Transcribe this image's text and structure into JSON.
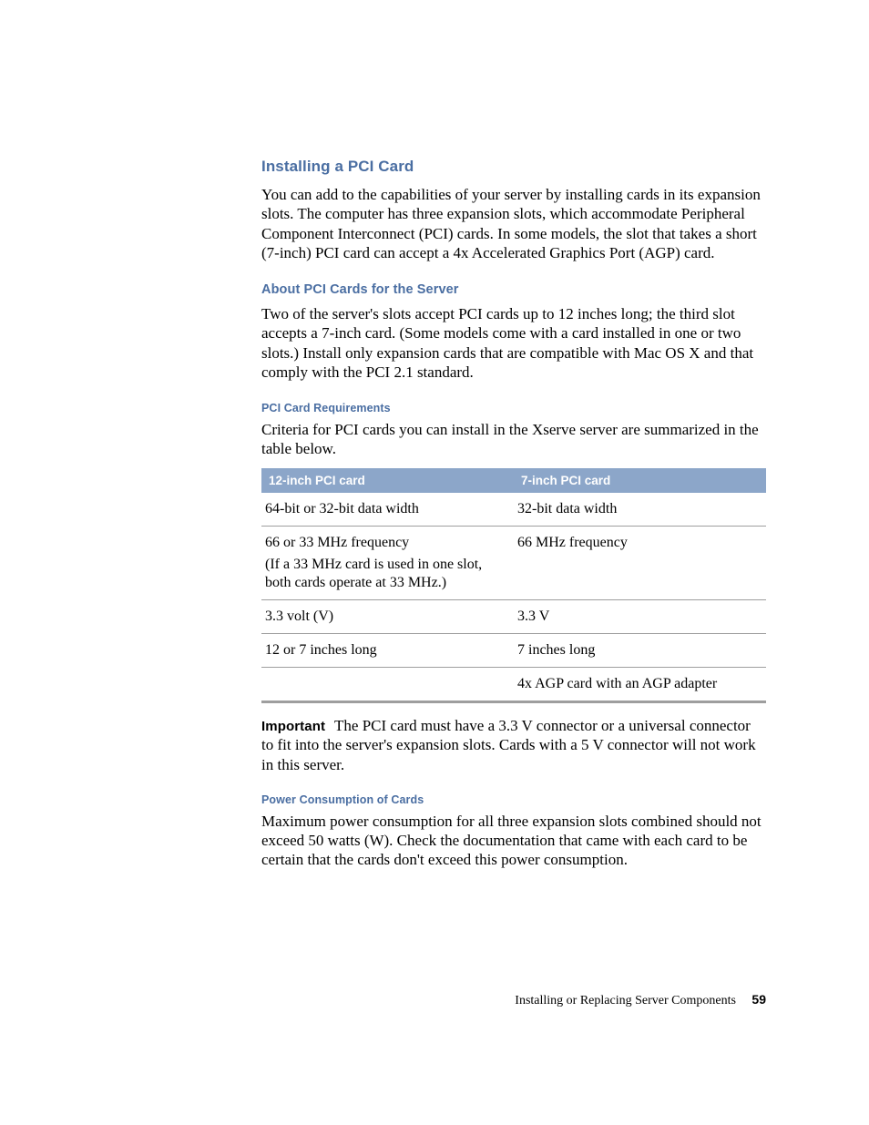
{
  "h1": "Installing a PCI Card",
  "p1": "You can add to the capabilities of your server by installing cards in its expansion slots. The computer has three expansion slots, which accommodate Peripheral Component Interconnect (PCI) cards. In some models, the slot that takes a short (7-inch) PCI card can accept a 4x Accelerated Graphics Port (AGP) card.",
  "h2a": "About PCI Cards for the Server",
  "p2": "Two of the server's slots accept PCI cards up to 12 inches long; the third slot accepts a 7-inch card. (Some models come with a card installed in one or two slots.) Install only expansion cards that are compatible with Mac OS X and that comply with the PCI 2.1 standard.",
  "h3a": "PCI Card Requirements",
  "p3": "Criteria for PCI cards you can install in the Xserve server are summarized in the table below.",
  "table": {
    "head": {
      "c1": "12-inch PCI card",
      "c2": "7-inch PCI card"
    },
    "rows": [
      {
        "c1": "64-bit or 32-bit data width",
        "c1b": "",
        "c2": "32-bit data width"
      },
      {
        "c1": "66 or 33 MHz frequency",
        "c1b": "(If a 33 MHz card is used in one slot, both cards operate at 33 MHz.)",
        "c2": "66 MHz frequency"
      },
      {
        "c1": "3.3 volt (V)",
        "c1b": "",
        "c2": "3.3 V"
      },
      {
        "c1": "12 or 7 inches long",
        "c1b": "",
        "c2": "7 inches long"
      },
      {
        "c1": "",
        "c1b": "",
        "c2": "4x AGP card with an AGP adapter"
      }
    ]
  },
  "important_lead": "Important",
  "important_body": "The PCI card must have a 3.3 V connector or a universal connector to fit into the server's expansion slots. Cards with a 5 V connector will not work in this server.",
  "h3b": "Power Consumption of Cards",
  "p4": "Maximum power consumption for all three expansion slots combined should not exceed 50 watts (W). Check the documentation that came with each card to be certain that the cards don't exceed this power consumption.",
  "footer": {
    "title": "Installing or Replacing Server Components",
    "page": "59"
  }
}
